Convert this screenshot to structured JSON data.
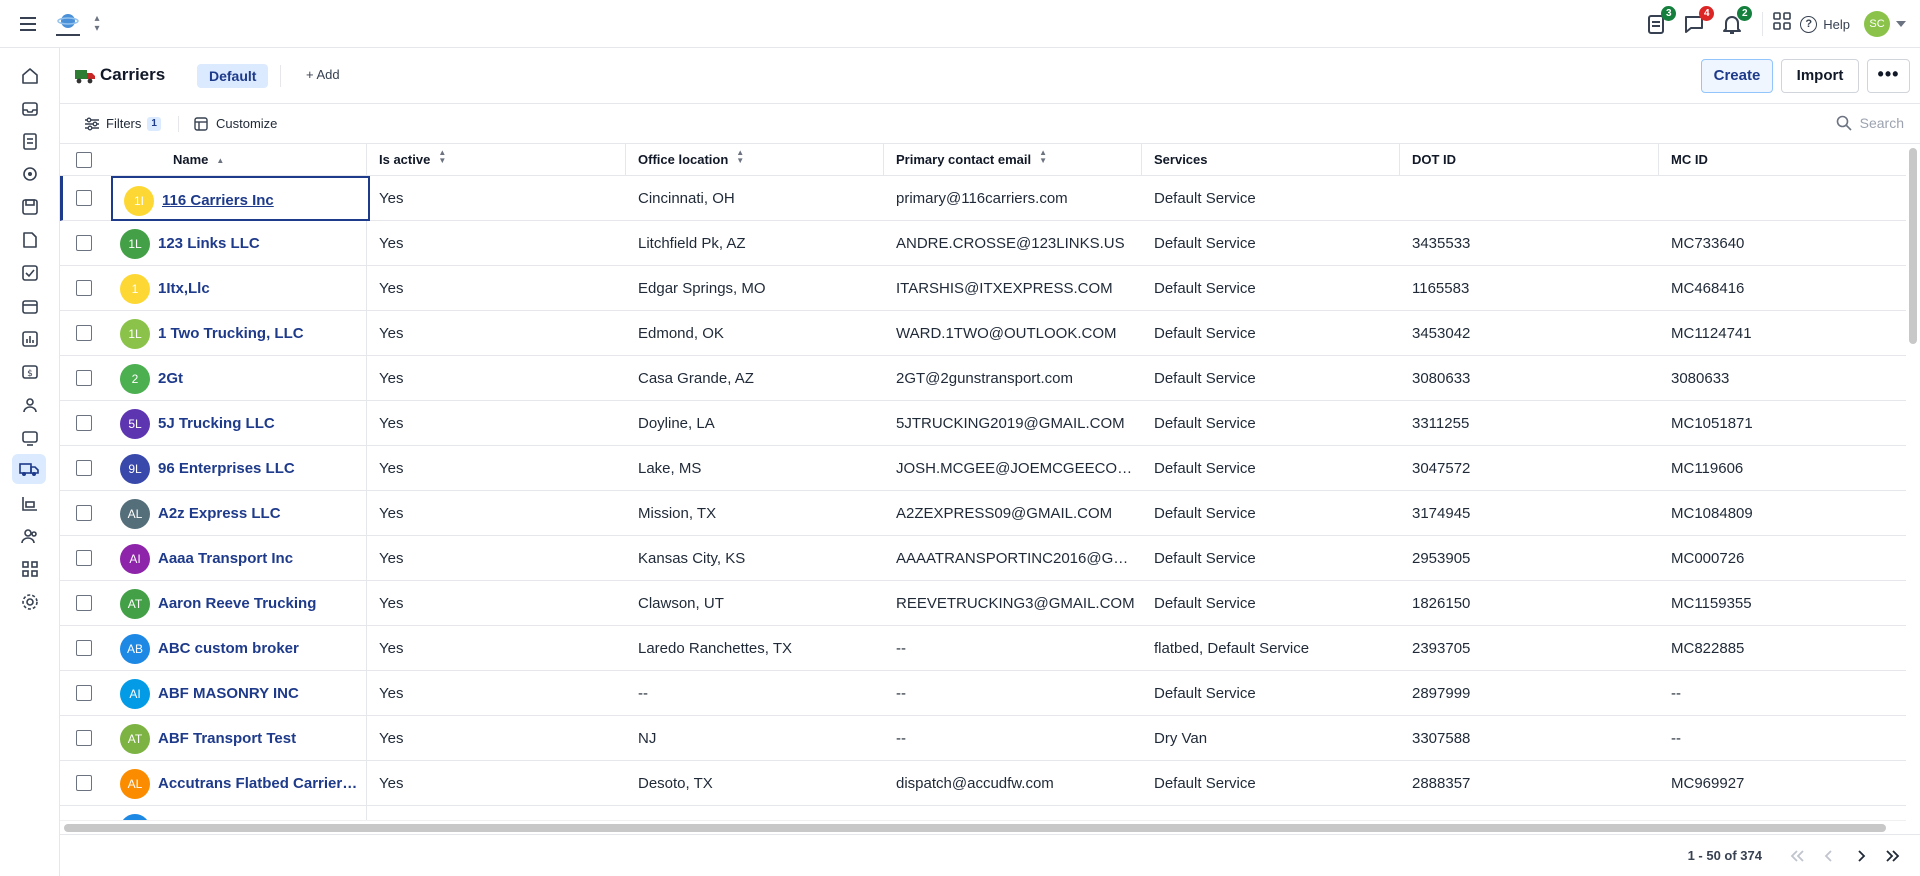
{
  "page": {
    "title": "Carriers"
  },
  "header": {
    "view_label": "Default",
    "add_label": "+ Add",
    "create_label": "Create",
    "import_label": "Import",
    "more_label": "•••"
  },
  "top": {
    "notifications": [
      {
        "icon": "clipboard-icon",
        "count": "3",
        "color": "#15803d"
      },
      {
        "icon": "chat-icon",
        "count": "4",
        "color": "#dc2626"
      },
      {
        "icon": "bell-icon",
        "count": "2",
        "color": "#15803d"
      }
    ],
    "help_label": "Help",
    "user_initials": "SC"
  },
  "filterbar": {
    "filters_label": "Filters",
    "filters_count": "1",
    "customize_label": "Customize",
    "search_placeholder": "Search"
  },
  "table": {
    "columns": [
      "Name",
      "Is active",
      "Office location",
      "Primary contact email",
      "Services",
      "DOT ID",
      "MC ID"
    ],
    "rows": [
      {
        "initials": "1I",
        "color": "#fdd835",
        "name": "116 Carriers Inc",
        "active": "Yes",
        "location": "Cincinnati, OH",
        "email": "primary@116carriers.com",
        "services": "Default Service",
        "dot": "",
        "mc": ""
      },
      {
        "initials": "1L",
        "color": "#43a047",
        "name": "123 Links LLC",
        "active": "Yes",
        "location": "Litchfield Pk, AZ",
        "email": "ANDRE.CROSSE@123LINKS.US",
        "services": "Default Service",
        "dot": "3435533",
        "mc": "MC733640"
      },
      {
        "initials": "1",
        "color": "#fdd835",
        "name": "1Itx,Llc",
        "active": "Yes",
        "location": "Edgar Springs, MO",
        "email": "ITARSHIS@ITXEXPRESS.COM",
        "services": "Default Service",
        "dot": "1165583",
        "mc": "MC468416"
      },
      {
        "initials": "1L",
        "color": "#8bc34a",
        "name": "1 Two Trucking, LLC",
        "active": "Yes",
        "location": "Edmond, OK",
        "email": "WARD.1TWO@OUTLOOK.COM",
        "services": "Default Service",
        "dot": "3453042",
        "mc": "MC1124741"
      },
      {
        "initials": "2",
        "color": "#4caf50",
        "name": "2Gt",
        "active": "Yes",
        "location": "Casa Grande, AZ",
        "email": "2GT@2gunstransport.com",
        "services": "Default Service",
        "dot": "3080633",
        "mc": "3080633"
      },
      {
        "initials": "5L",
        "color": "#5e35b1",
        "name": "5J Trucking LLC",
        "active": "Yes",
        "location": "Doyline, LA",
        "email": "5JTRUCKING2019@GMAIL.COM",
        "services": "Default Service",
        "dot": "3311255",
        "mc": "MC1051871"
      },
      {
        "initials": "9L",
        "color": "#3949ab",
        "name": "96 Enterprises LLC",
        "active": "Yes",
        "location": "Lake, MS",
        "email": "JOSH.MCGEE@JOEMCGEECONST.C...",
        "services": "Default Service",
        "dot": "3047572",
        "mc": "MC119606"
      },
      {
        "initials": "AL",
        "color": "#546e7a",
        "name": "A2z Express LLC",
        "active": "Yes",
        "location": "Mission, TX",
        "email": "A2ZEXPRESS09@GMAIL.COM",
        "services": "Default Service",
        "dot": "3174945",
        "mc": "MC1084809"
      },
      {
        "initials": "AI",
        "color": "#8e24aa",
        "name": "Aaaa Transport Inc",
        "active": "Yes",
        "location": "Kansas City, KS",
        "email": "AAAATRANSPORTINC2016@GMAI...",
        "services": "Default Service",
        "dot": "2953905",
        "mc": "MC000726"
      },
      {
        "initials": "AT",
        "color": "#43a047",
        "name": "Aaron Reeve Trucking",
        "active": "Yes",
        "location": "Clawson, UT",
        "email": "REEVETRUCKING3@GMAIL.COM",
        "services": "Default Service",
        "dot": "1826150",
        "mc": "MC1159355"
      },
      {
        "initials": "AB",
        "color": "#1e88e5",
        "name": "ABC custom broker",
        "active": "Yes",
        "location": "Laredo Ranchettes, TX",
        "email": "--",
        "services": "flatbed, Default Service",
        "dot": "2393705",
        "mc": "MC822885"
      },
      {
        "initials": "AI",
        "color": "#039be5",
        "name": "ABF MASONRY INC",
        "active": "Yes",
        "location": "--",
        "email": "--",
        "services": "Default Service",
        "dot": "2897999",
        "mc": "--"
      },
      {
        "initials": "AT",
        "color": "#7cb342",
        "name": "ABF Transport Test",
        "active": "Yes",
        "location": "NJ",
        "email": "--",
        "services": "Dry Van",
        "dot": "3307588",
        "mc": "--"
      },
      {
        "initials": "AL",
        "color": "#fb8c00",
        "name": "Accutrans Flatbed Carriers...",
        "active": "Yes",
        "location": "Desoto, TX",
        "email": "dispatch@accudfw.com",
        "services": "Default Service",
        "dot": "2888357",
        "mc": "MC969927"
      },
      {
        "initials": "",
        "color": "#1e88e5",
        "name": "",
        "active": "",
        "location": "",
        "email": "",
        "services": "",
        "dot": "",
        "mc": ""
      }
    ]
  },
  "footer": {
    "range_label": "1 - 50 of 374"
  }
}
